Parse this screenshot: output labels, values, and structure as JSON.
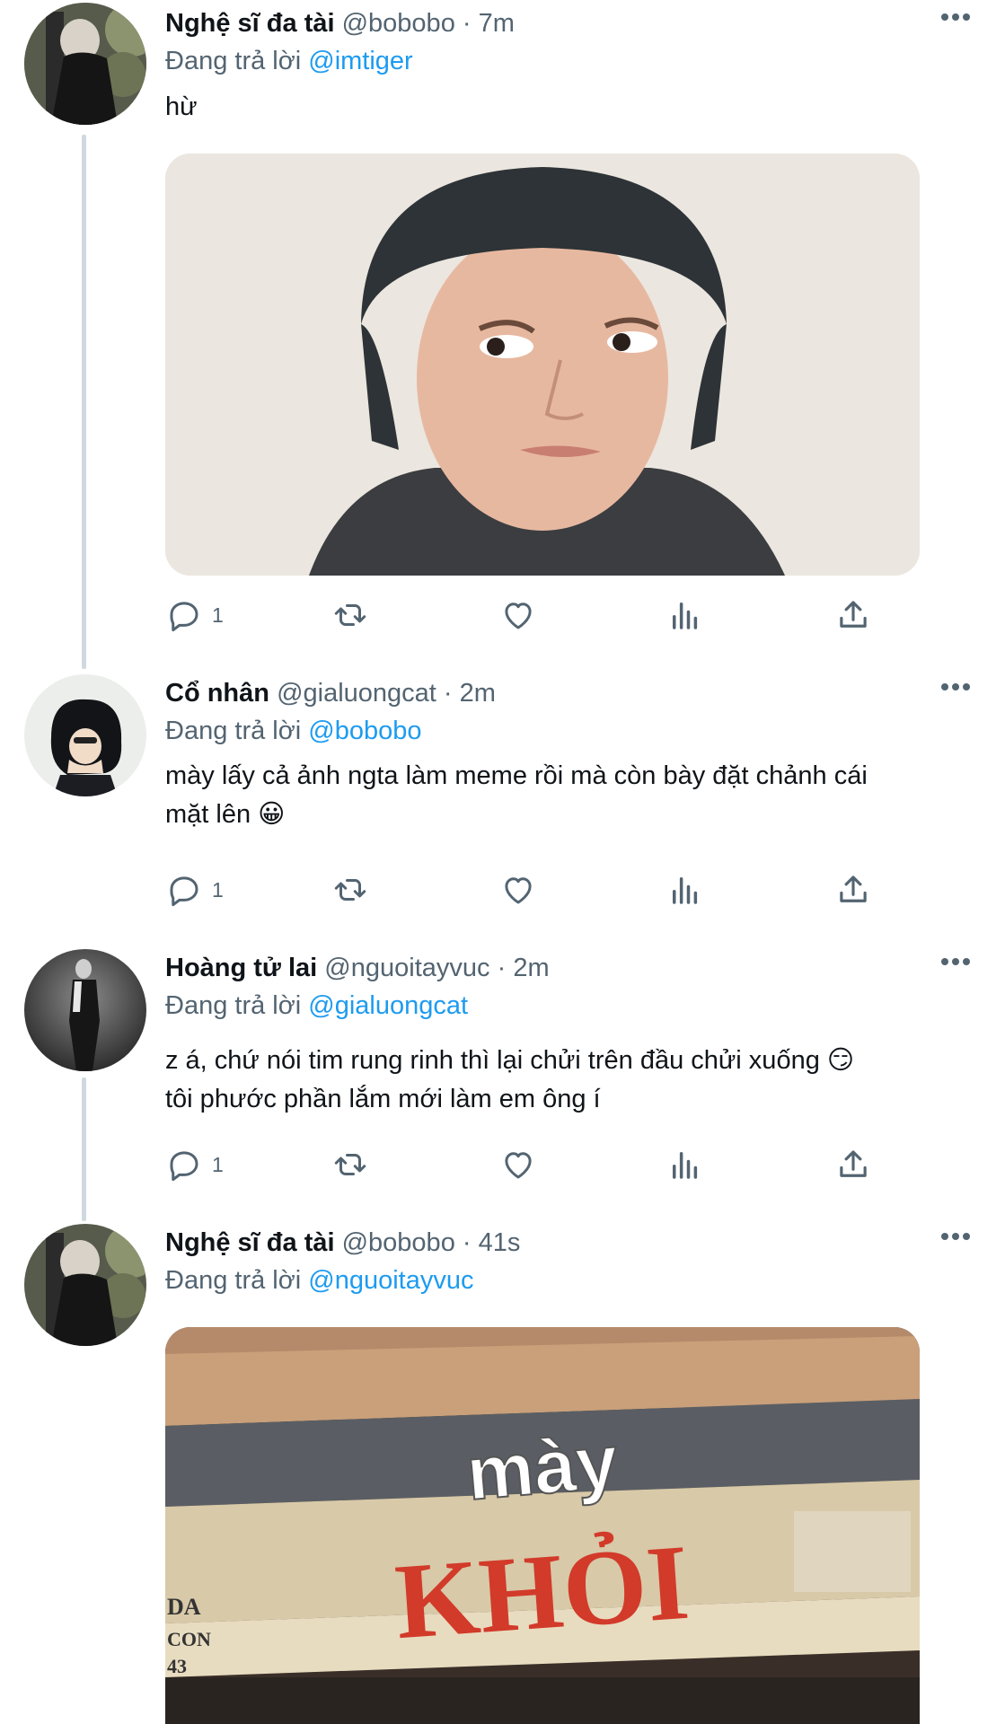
{
  "colors": {
    "accent": "#1d9bf0",
    "muted": "#536471",
    "text": "#0f1419",
    "thread_line": "#cfd9de"
  },
  "tweets": [
    {
      "name": "Nghệ sĩ đa tài",
      "handle": "@bobobo",
      "separator": "·",
      "time": "7m",
      "replying_prefix": "Đang trả lời",
      "replying_to": "@imtiger",
      "text_lines": [
        "hừ"
      ],
      "media": "photo of young man in dark beanie looking sideways",
      "actions": {
        "reply_count": "1",
        "retweet_count": "",
        "like_count": ""
      }
    },
    {
      "name": "Cổ nhân",
      "handle": "@gialuongcat",
      "separator": "·",
      "time": "2m",
      "replying_prefix": "Đang trả lời",
      "replying_to": "@bobobo",
      "text_lines": [
        "mày lấy cả ảnh ngta làm meme rồi mà còn bày đặt chảnh cái",
        "mặt lên 😀"
      ],
      "actions": {
        "reply_count": "1",
        "retweet_count": "",
        "like_count": ""
      }
    },
    {
      "name": "Hoàng tử lai",
      "handle": "@nguoitayvuc",
      "separator": "·",
      "time": "2m",
      "replying_prefix": "Đang trả lời",
      "replying_to": "@gialuongcat",
      "text_lines": [
        "z á, chứ nói tim rung rinh thì lại chửi trên đầu chửi xuống 😏",
        "tôi phước phần lắm mới làm em ông í"
      ],
      "actions": {
        "reply_count": "1",
        "retweet_count": "",
        "like_count": ""
      }
    },
    {
      "name": "Nghệ sĩ đa tài",
      "handle": "@bobobo",
      "separator": "·",
      "time": "41s",
      "replying_prefix": "Đang trả lời",
      "replying_to": "@nguoitayvuc",
      "media": "meme of shop sign",
      "media_caption": "mày",
      "sign_text": "KHỎI",
      "sign_side_text": [
        "DA",
        "CON",
        "43"
      ]
    }
  ],
  "icons": [
    "more-icon",
    "reply-icon",
    "retweet-icon",
    "like-icon",
    "analytics-icon",
    "share-icon"
  ]
}
